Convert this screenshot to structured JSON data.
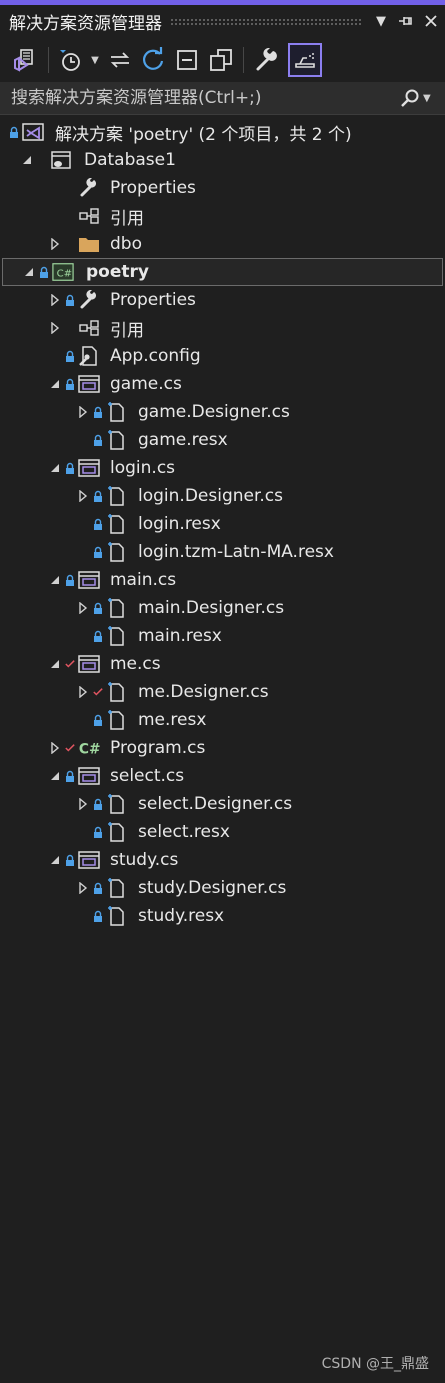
{
  "window": {
    "title": "解决方案资源管理器",
    "buttons": [
      "dropdown-icon",
      "pin-icon",
      "close-icon"
    ]
  },
  "toolbar": {
    "items": [
      "vs-switch-views-icon",
      "history-icon",
      "dropdown-icon",
      "sync-icon",
      "refresh-icon",
      "collapse-all-icon",
      "show-all-files-icon",
      "properties-wrench-icon",
      "preview-icon"
    ],
    "active_item": "preview-icon"
  },
  "search": {
    "placeholder": "搜索解决方案资源管理器(Ctrl+;)"
  },
  "tree": [
    {
      "label": "解决方案 'poetry' (2 个项目，共 2 个)",
      "icon": "solution-icon",
      "expander": "none",
      "lock": true
    },
    {
      "label": "Database1",
      "icon": "database-project-icon",
      "expander": "expanded",
      "lock": false
    },
    {
      "label": "Properties",
      "icon": "wrench-icon",
      "expander": "none",
      "lock": false
    },
    {
      "label": "引用",
      "icon": "references-icon",
      "expander": "none",
      "lock": false
    },
    {
      "label": "dbo",
      "icon": "folder-icon",
      "expander": "collapsed",
      "lock": false
    },
    {
      "label": "poetry",
      "icon": "csharp-project-icon",
      "expander": "expanded",
      "lock": true,
      "bold": true,
      "selected": true
    },
    {
      "label": "Properties",
      "icon": "wrench-icon",
      "expander": "collapsed",
      "lock": true
    },
    {
      "label": "引用",
      "icon": "references-icon",
      "expander": "collapsed",
      "lock": false
    },
    {
      "label": "App.config",
      "icon": "config-file-icon",
      "expander": "none",
      "lock": true
    },
    {
      "label": "game.cs",
      "icon": "form-icon",
      "expander": "expanded",
      "lock": true
    },
    {
      "label": "game.Designer.cs",
      "icon": "file-icon",
      "expander": "collapsed",
      "lock": true
    },
    {
      "label": "game.resx",
      "icon": "file-icon",
      "expander": "none",
      "lock": true
    },
    {
      "label": "login.cs",
      "icon": "form-icon",
      "expander": "expanded",
      "lock": true
    },
    {
      "label": "login.Designer.cs",
      "icon": "file-icon",
      "expander": "collapsed",
      "lock": true
    },
    {
      "label": "login.resx",
      "icon": "file-icon",
      "expander": "none",
      "lock": true
    },
    {
      "label": "login.tzm-Latn-MA.resx",
      "icon": "file-icon",
      "expander": "none",
      "lock": true
    },
    {
      "label": "main.cs",
      "icon": "form-icon",
      "expander": "expanded",
      "lock": true
    },
    {
      "label": "main.Designer.cs",
      "icon": "file-icon",
      "expander": "collapsed",
      "lock": true
    },
    {
      "label": "main.resx",
      "icon": "file-icon",
      "expander": "none",
      "lock": true
    },
    {
      "label": "me.cs",
      "icon": "form-icon",
      "expander": "expanded",
      "check": true
    },
    {
      "label": "me.Designer.cs",
      "icon": "file-icon",
      "expander": "collapsed",
      "check": true
    },
    {
      "label": "me.resx",
      "icon": "file-icon",
      "expander": "none",
      "lock": true
    },
    {
      "label": "Program.cs",
      "icon": "csharp-file-icon",
      "expander": "collapsed",
      "check": true
    },
    {
      "label": "select.cs",
      "icon": "form-icon",
      "expander": "expanded",
      "lock": true
    },
    {
      "label": "select.Designer.cs",
      "icon": "file-icon",
      "expander": "collapsed",
      "lock": true
    },
    {
      "label": "select.resx",
      "icon": "file-icon",
      "expander": "none",
      "lock": true
    },
    {
      "label": "study.cs",
      "icon": "form-icon",
      "expander": "expanded",
      "lock": true
    },
    {
      "label": "study.Designer.cs",
      "icon": "file-icon",
      "expander": "collapsed",
      "lock": true
    },
    {
      "label": "study.resx",
      "icon": "file-icon",
      "expander": "none",
      "lock": true
    }
  ],
  "watermark": "CSDN @王_鼎盛",
  "colors": {
    "background": "#1f1f1f",
    "accent": "#7160e8",
    "lock": "#4ea1e8",
    "check": "#e05561",
    "form_icon": "#a58de8",
    "folder": "#d9a55c"
  }
}
